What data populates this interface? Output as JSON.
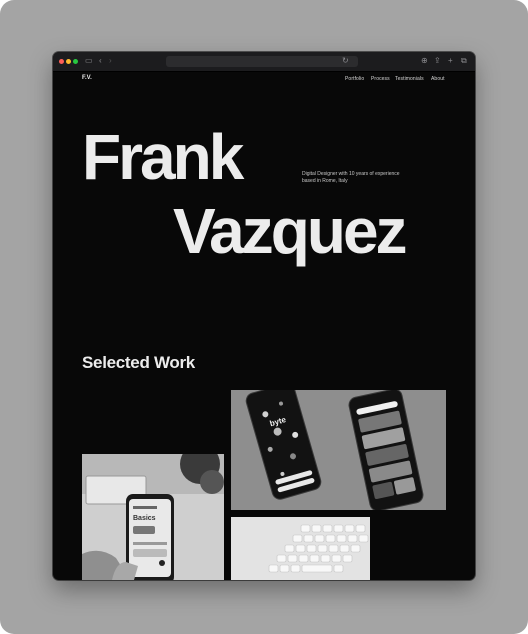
{
  "header": {
    "logo": "F.V.",
    "nav": [
      "Portfolio",
      "Process",
      "Testimonials",
      "About"
    ]
  },
  "hero": {
    "first_name": "Frank",
    "last_name": "Vazquez",
    "intro": "Digital Designer with 10 years of experience based in Rome, Italy"
  },
  "work": {
    "heading": "Selected Work",
    "app_title": "byte",
    "phone_item": "Basics"
  },
  "colors": {
    "background": "#080808",
    "text": "#ececec",
    "frame": "#a4a4a4"
  }
}
